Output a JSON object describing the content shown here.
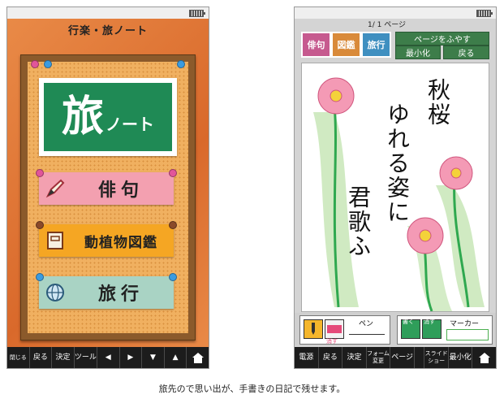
{
  "left_device": {
    "title": "行楽・旅ノート",
    "logo": {
      "big": "旅",
      "small": "ノート"
    },
    "menu": [
      {
        "label": "俳句",
        "icon": "pen-icon",
        "color": "#f3a0b0"
      },
      {
        "label": "動植物図鑑",
        "icon": "notebook-icon",
        "color": "#f5a623"
      },
      {
        "label": "旅行",
        "icon": "globe-icon",
        "color": "#a9d3c4"
      }
    ],
    "bottom_bar": [
      "閉じる",
      "戻る",
      "決定",
      "ツール",
      "◀",
      "▶",
      "▼",
      "▲"
    ]
  },
  "right_device": {
    "page_indicator": "1/ 1 ページ",
    "categories": [
      {
        "label": "俳句",
        "color": "#c65a8f"
      },
      {
        "label": "図鑑",
        "color": "#d98a3a"
      },
      {
        "label": "旅行",
        "color": "#3f8fc0"
      }
    ],
    "controls": {
      "add_page": "ページをふやす",
      "minimize": "最小化",
      "back": "戻る"
    },
    "poem_lines": [
      "秋桜",
      "ゆれる姿に",
      "君歌ふ"
    ],
    "tools": {
      "erase_label": "消す",
      "pen_label": "ペン",
      "write_label": "書く",
      "erase2_label": "消す",
      "marker_label": "マーカー"
    },
    "bottom_bar": [
      "電源",
      "戻る",
      "決定",
      "フォーム変更",
      "ページ",
      "スライドショー",
      "最小化"
    ]
  },
  "caption": "旅先ので思い出が、手書きの日記で残せます。"
}
